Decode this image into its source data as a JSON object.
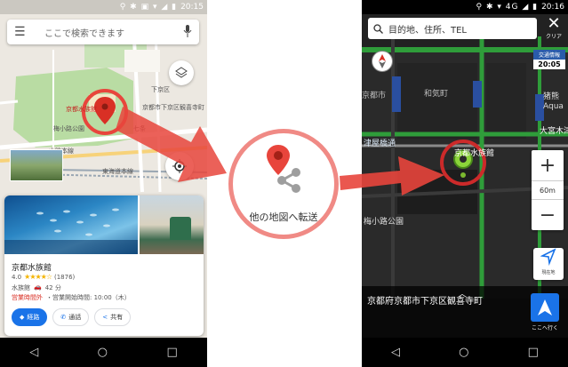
{
  "left_screen": {
    "status_time": "20:15",
    "status_icons": "⚲ ✱ ▣ ▾ ◢ ▮",
    "search": {
      "placeholder": "ここで検索できます"
    },
    "map_labels": {
      "aquarium": "京都水族館",
      "umekoji_park": "梅小路公園",
      "address_area": "京都市下京区観喜寺町",
      "kamikyo": "下京区",
      "shichijo": "七条",
      "yamaguchi": "山陰本線",
      "tokaido": "東海道本線"
    },
    "place": {
      "name": "京都水族館",
      "rating": "4.0",
      "stars": "★★★★☆",
      "review_count": "(1876)",
      "category": "水族館",
      "drive_time": "42 分",
      "status": "営業時間外",
      "opens": "・営業開始時間: 10:00（木）",
      "actions": [
        "経路",
        "通話",
        "共有"
      ]
    }
  },
  "middle": {
    "label": "他の地図へ転送"
  },
  "right_screen": {
    "status_time": "20:16",
    "status_icons": "⚲ ✱ ▾ 4G ◢ ▮",
    "search": {
      "placeholder": "目的地、住所、TEL"
    },
    "clear_label": "クリア",
    "traffic_label": "交通情報",
    "clock": "20:05",
    "map_labels": {
      "aquarium": "京都水族館",
      "umekoji_park": "梅小路公園",
      "wanami": "和気町",
      "kyoto_center": "京都市",
      "tsumeya": "津屋橋通",
      "omiya": "大宮木津",
      "inokuma": "猪熊",
      "aqua": "Aqua"
    },
    "scale": "60m",
    "current_label": "現在地",
    "address": "京都府京都市下京区観喜寺町",
    "go_label": "ここへ行く"
  },
  "colors": {
    "accent_red": "#e8453c",
    "pin_green": "#8bd43a",
    "google_blue": "#1a73e8"
  }
}
